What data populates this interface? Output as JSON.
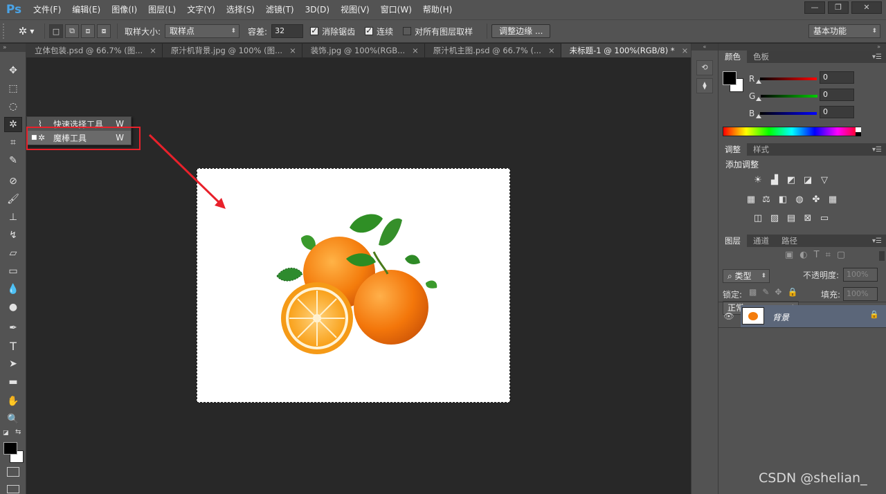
{
  "app": {
    "logo": "Ps"
  },
  "menubar": {
    "items": [
      "文件(F)",
      "编辑(E)",
      "图像(I)",
      "图层(L)",
      "文字(Y)",
      "选择(S)",
      "滤镜(T)",
      "3D(D)",
      "视图(V)",
      "窗口(W)",
      "帮助(H)"
    ],
    "window_buttons": [
      "—",
      "❐",
      "✕"
    ]
  },
  "options": {
    "sample_size_label": "取样大小:",
    "sample_size_value": "取样点",
    "tolerance_label": "容差:",
    "tolerance_value": "32",
    "antialias_label": "消除锯齿",
    "antialias_checked": true,
    "contiguous_label": "连续",
    "contiguous_checked": true,
    "sample_all_label": "对所有图层取样",
    "sample_all_checked": false,
    "refine_edge_label": "调整边缘 ...",
    "workspace_value": "基本功能"
  },
  "tabs": [
    {
      "label": "立体包装.psd @ 66.7% (图...",
      "active": false
    },
    {
      "label": "原汁机背景.jpg @ 100% (图...",
      "active": false
    },
    {
      "label": "装饰.jpg @ 100%(RGB...",
      "active": false
    },
    {
      "label": "原汁机主图.psd @ 66.7% (...",
      "active": false
    },
    {
      "label": "未标题-1 @ 100%(RGB/8) *",
      "active": true
    }
  ],
  "flyout": {
    "items": [
      {
        "label": "快速选择工具",
        "shortcut": "W",
        "selected": false
      },
      {
        "label": "魔棒工具",
        "shortcut": "W",
        "selected": true
      }
    ]
  },
  "color_panel": {
    "tabs": [
      "颜色",
      "色板"
    ],
    "channels": [
      {
        "name": "R",
        "value": "0",
        "color": "#ff0000"
      },
      {
        "name": "G",
        "value": "0",
        "color": "#00cc00"
      },
      {
        "name": "B",
        "value": "0",
        "color": "#0000ff"
      }
    ]
  },
  "adjust_panel": {
    "tabs": [
      "调整",
      "样式"
    ],
    "title": "添加调整"
  },
  "layers_panel": {
    "tabs": [
      "图层",
      "通道",
      "路径"
    ],
    "filter_label": "类型",
    "blend_mode": "正常",
    "opacity_label": "不透明度:",
    "opacity_value": "100%",
    "lock_label": "锁定:",
    "fill_label": "填充:",
    "fill_value": "100%",
    "layers": [
      {
        "name": "背景",
        "locked": true,
        "visible": true
      }
    ]
  },
  "watermark": "CSDN @shelian_"
}
